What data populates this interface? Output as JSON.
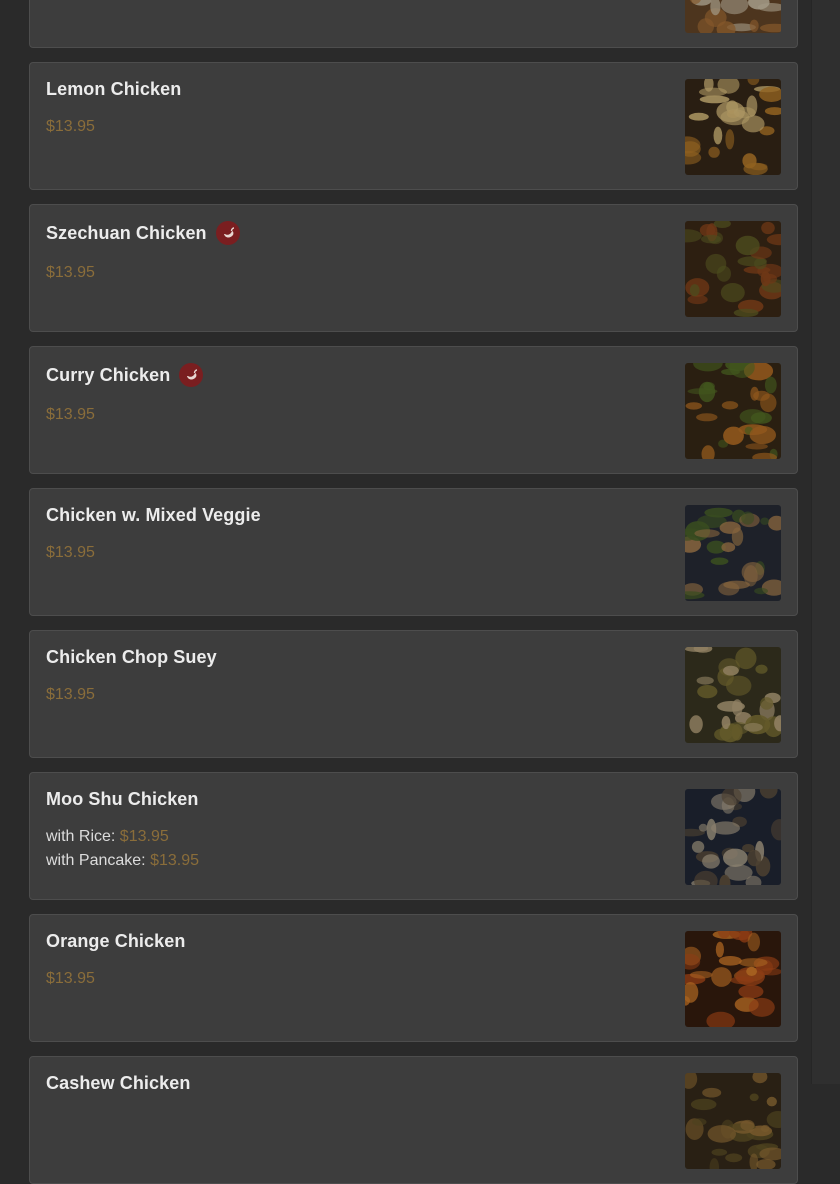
{
  "menu_items": [
    {
      "name": "",
      "spicy": false,
      "prices": [],
      "thumb": [
        "#6b4a2a",
        "#b97a3c",
        "#e0d3b8"
      ]
    },
    {
      "name": "Lemon Chicken",
      "spicy": false,
      "prices": [
        {
          "label": "",
          "value": "$13.95"
        }
      ],
      "thumb": [
        "#3a2a1a",
        "#c9882d",
        "#f0d28a"
      ]
    },
    {
      "name": "Szechuan Chicken",
      "spicy": true,
      "prices": [
        {
          "label": "",
          "value": "$13.95"
        }
      ],
      "thumb": [
        "#3f2b18",
        "#9a4d1f",
        "#6a6a2a"
      ]
    },
    {
      "name": "Curry Chicken",
      "spicy": true,
      "prices": [
        {
          "label": "",
          "value": "$13.95"
        }
      ],
      "thumb": [
        "#3b2c18",
        "#c97a28",
        "#5c7a2a"
      ]
    },
    {
      "name": "Chicken w. Mixed Veggie",
      "spicy": false,
      "prices": [
        {
          "label": "",
          "value": "$13.95"
        }
      ],
      "thumb": [
        "#2a2f3a",
        "#4f6a2c",
        "#b88a55"
      ]
    },
    {
      "name": "Chicken Chop Suey",
      "spicy": false,
      "prices": [
        {
          "label": "",
          "value": "$13.95"
        }
      ],
      "thumb": [
        "#3d3a25",
        "#8a7d3a",
        "#c9b38a"
      ]
    },
    {
      "name": "Moo Shu Chicken",
      "spicy": false,
      "prices": [
        {
          "label": "with Rice: ",
          "value": "$13.95"
        },
        {
          "label": "with Pancake: ",
          "value": "$13.95"
        }
      ],
      "thumb": [
        "#232a3a",
        "#6b5a44",
        "#c2b49a"
      ]
    },
    {
      "name": "Orange Chicken",
      "spicy": false,
      "prices": [
        {
          "label": "",
          "value": "$13.95"
        }
      ],
      "thumb": [
        "#3a1f10",
        "#c2531c",
        "#e8892e"
      ]
    },
    {
      "name": "Cashew Chicken",
      "spicy": false,
      "prices": [],
      "thumb": [
        "#3a2d1c",
        "#a57c3e",
        "#6a5a2a"
      ]
    }
  ]
}
